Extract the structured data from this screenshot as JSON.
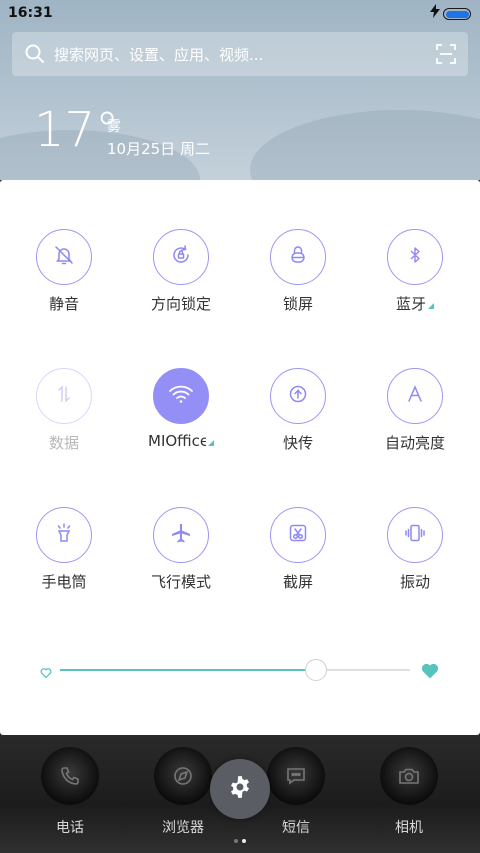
{
  "status_bar": {
    "time": "16:31",
    "battery_level": 1.0
  },
  "search": {
    "placeholder": "搜索网页、设置、应用、视频..."
  },
  "weather": {
    "temperature": "17°",
    "condition": "雾",
    "date": "10月25日 周二"
  },
  "toggles": [
    {
      "label": "静音",
      "icon": "bell-off-icon",
      "state": "off"
    },
    {
      "label": "方向锁定",
      "icon": "rotation-lock-icon",
      "state": "off"
    },
    {
      "label": "锁屏",
      "icon": "lock-icon",
      "state": "off"
    },
    {
      "label": "蓝牙",
      "icon": "bluetooth-icon",
      "state": "off",
      "has_submenu": true
    },
    {
      "label": "数据",
      "icon": "mobile-data-icon",
      "state": "disabled"
    },
    {
      "label": "MIOffice",
      "icon": "wifi-icon",
      "state": "on",
      "has_submenu": true
    },
    {
      "label": "快传",
      "icon": "quick-transfer-icon",
      "state": "off"
    },
    {
      "label": "自动亮度",
      "icon": "auto-brightness-icon",
      "state": "off"
    },
    {
      "label": "手电筒",
      "icon": "flashlight-icon",
      "state": "off"
    },
    {
      "label": "飞行模式",
      "icon": "airplane-icon",
      "state": "off"
    },
    {
      "label": "截屏",
      "icon": "screenshot-icon",
      "state": "off"
    },
    {
      "label": "振动",
      "icon": "vibrate-icon",
      "state": "off"
    }
  ],
  "brightness": {
    "level": 0.73
  },
  "dock": {
    "apps": [
      {
        "label": "电话",
        "icon": "phone-icon"
      },
      {
        "label": "浏览器",
        "icon": "browser-icon"
      },
      {
        "label": "短信",
        "icon": "message-icon"
      },
      {
        "label": "相机",
        "icon": "camera-icon"
      }
    ],
    "page_count": 2,
    "active_page": 2
  },
  "colors": {
    "accent": "#948ff7",
    "slider": "#57c3bd"
  }
}
